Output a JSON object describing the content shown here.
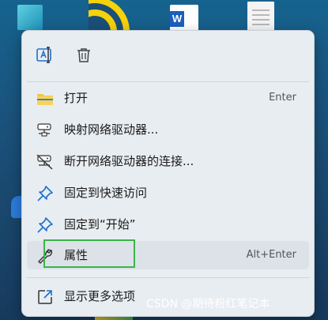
{
  "desktop": {
    "word_icon_letter": "W",
    "left_fragments": [
      "",
      "",
      "",
      "",
      "",
      ""
    ]
  },
  "quick_actions": {
    "rename_icon": "rename-icon",
    "delete_icon": "trash-icon"
  },
  "menu": {
    "items": [
      {
        "label": "打开",
        "shortcut": "Enter",
        "icon": "folder-icon"
      },
      {
        "label": "映射网络驱动器...",
        "shortcut": "",
        "icon": "map-network-drive-icon"
      },
      {
        "label": "断开网络驱动器的连接...",
        "shortcut": "",
        "icon": "disconnect-network-drive-icon"
      },
      {
        "label": "固定到快速访问",
        "shortcut": "",
        "icon": "pin-icon"
      },
      {
        "label": "固定到“开始”",
        "shortcut": "",
        "icon": "pin-icon"
      },
      {
        "label": "属性",
        "shortcut": "Alt+Enter",
        "icon": "wrench-icon"
      }
    ],
    "more_options": {
      "label": "显示更多选项",
      "icon": "open-external-icon"
    }
  },
  "colors": {
    "menu_bg": "#e8edf1",
    "highlight_border": "#3bb54a",
    "pin_blue": "#1f6fd0",
    "folder_yellow": "#f4c542"
  },
  "watermark": "CSDN @期待粉红笔记本"
}
